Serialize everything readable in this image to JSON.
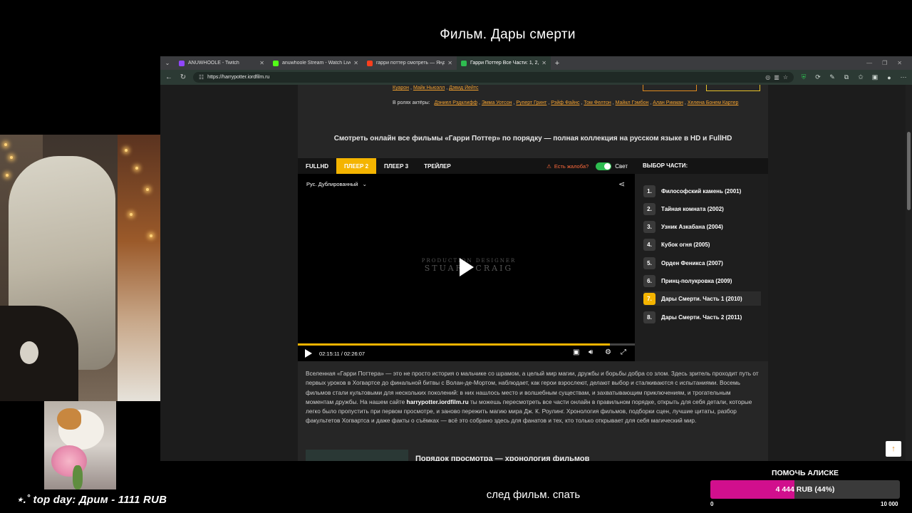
{
  "overlay": {
    "title": "Фильм.   Дары смерти",
    "bottom_text": "след фильм.  спать",
    "top_day": "⋆.˚ top day: Дрим - 1111 RUB"
  },
  "browser": {
    "tabs": [
      {
        "label": "ANUWHOOLE - Twitch",
        "active": false,
        "icon_color": "#9146ff"
      },
      {
        "label": "anuwhoole Stream - Watch Live o",
        "active": false,
        "icon_color": "#53fc18"
      },
      {
        "label": "гарри поттер смотреть — Яндекс",
        "active": false,
        "icon_color": "#fc3f1d"
      },
      {
        "label": "Гарри Поттер Все Части: 1, 2, 3,",
        "active": true,
        "icon_color": "#2ebd50"
      }
    ],
    "new_tab": "+",
    "url": "https://harrypotter.iordfilm.ru"
  },
  "page": {
    "credits": {
      "directors": [
        "Куарон",
        "Майк Ньюэлл",
        "Дэвид Йейтс"
      ],
      "cast_label": "В ролях актёры:",
      "cast": [
        "Дэниел Рэдклифф",
        "Эмма Уотсон",
        "Руперт Гринт",
        "Рэйф Файнс",
        "Том Фелтон",
        "Майкл Гэмбон",
        "Алан Рикман",
        "Хелена Бонем Картер"
      ]
    },
    "heading": "Смотреть онлайн все фильмы «Гарри Поттер» по порядку — полная коллекция на русском языке в HD и FullHD",
    "player_tabs": [
      "FULLHD",
      "ПЛЕЕР 2",
      "ПЛЕЕР 3",
      "ТРЕЙЛЕР"
    ],
    "active_player_tab": 1,
    "complaint": "Есть жалоба?",
    "light_label": "Свет",
    "light_on": true,
    "audio_track": "Рус. Дублированный",
    "video_credit_line1": "PRODUCTION DESIGNER",
    "video_credit_line2": "STUART CRAIG",
    "time": "02:15:11 / 02:26:07",
    "progress": 0.925,
    "parts_title": "ВЫБОР ЧАСТИ:",
    "parts": [
      {
        "num": "1.",
        "title": "Философский камень (2001)"
      },
      {
        "num": "2.",
        "title": "Тайная комната (2002)"
      },
      {
        "num": "3.",
        "title": "Узник Азкабана (2004)"
      },
      {
        "num": "4.",
        "title": "Кубок огня (2005)"
      },
      {
        "num": "5.",
        "title": "Орден Феникса (2007)"
      },
      {
        "num": "6.",
        "title": "Принц-полукровка (2009)"
      },
      {
        "num": "7.",
        "title": "Дары Смерти. Часть 1 (2010)"
      },
      {
        "num": "8.",
        "title": "Дары Смерти. Часть 2 (2011)"
      }
    ],
    "active_part": 6,
    "description_pre": "Вселенная «Гарри Поттера» — это не просто история о мальчике со шрамом, а целый мир магии, дружбы и борьбы добра со злом. Здесь зритель проходит путь от первых уроков в Хогвартсе до финальной битвы с Волан-де-Мортом, наблюдает, как герои взрослеют, делают выбор и сталкиваются с испытаниями. Восемь фильмов стали культовыми для нескольких поколений: в них нашлось место и волшебным существам, и захватывающим приключениям, и трогательным моментам дружбы. На нашем сайте ",
    "description_site": "harrypotter.iordfilm.ru",
    "description_post": " ты можешь пересмотреть все части онлайн в правильном порядке, открыть для себя детали, которые легко было пропустить при первом просмотре, и заново пережить магию мира Дж. К. Роулинг. Хронология фильмов, подборки сцен, лучшие цитаты, разбор факультетов Хогвартса и даже факты о съёмках — всё это собрано здесь для фанатов и тех, кто только открывает для себя магический мир.",
    "sub_heading": "Порядок просмотра — хронология фильмов",
    "to_top_icon": "↑"
  },
  "donation": {
    "title": "ПОМОЧЬ АЛИСКЕ",
    "amount_text": "4 444 RUB (44%)",
    "progress": 0.4444,
    "min": "0",
    "max": "10 000",
    "color": "#d10f8d"
  },
  "icons": {
    "reload": "↻",
    "back": "←",
    "share": "share-icon",
    "settings": "gear-icon"
  }
}
